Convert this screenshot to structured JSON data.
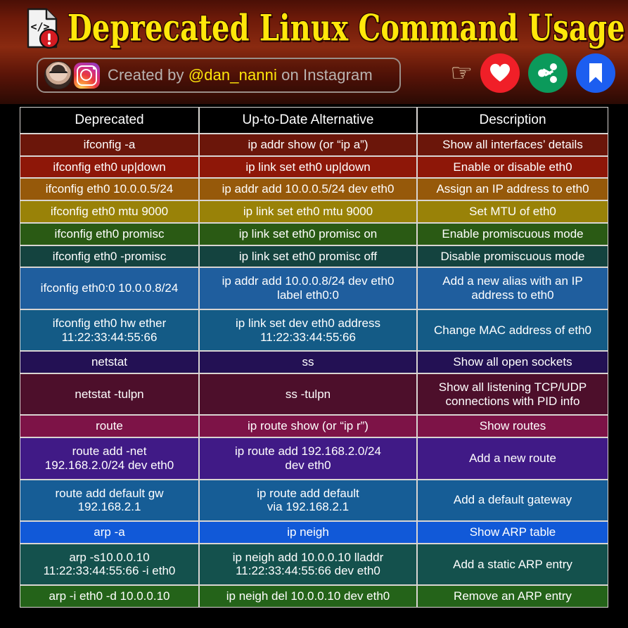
{
  "header": {
    "title": "Deprecated Linux Command Usage",
    "doc_icon": "code-document-alert-icon",
    "credit": {
      "avatar_icon": "user-avatar",
      "instagram_icon": "instagram-icon",
      "prefix": "Created by ",
      "handle": "@dan_nanni",
      "suffix": " on Instagram"
    },
    "actions": [
      {
        "name": "pointing-hand-icon",
        "glyph": "☞"
      },
      {
        "name": "heart-icon",
        "label": "Like"
      },
      {
        "name": "share-icon",
        "label": "Share"
      },
      {
        "name": "bookmark-icon",
        "label": "Save"
      }
    ],
    "colors": {
      "title_text": "#ffe70a",
      "handle_text": "#ffe70a",
      "credit_text": "#b9b3b0",
      "heart_bg": "#f01f28",
      "share_bg": "#0b9a5b",
      "save_bg": "#1c5ef0",
      "header_bg": "#6d1a09"
    }
  },
  "table": {
    "columns": [
      "Deprecated",
      "Up-to-Date Alternative",
      "Description"
    ],
    "header_bg": "#000000",
    "border_color": "#d9d5d2",
    "rows": [
      {
        "deprecated": "ifconfig -a",
        "alternative": "ip addr show (or “ip a”)",
        "description": "Show all interfaces’ details",
        "bg": "#6b160a",
        "tall": false
      },
      {
        "deprecated": "ifconfig eth0 up|down",
        "alternative": "ip link set eth0 up|down",
        "description": "Enable or disable eth0",
        "bg": "#8e1708",
        "tall": false
      },
      {
        "deprecated": "ifconfig eth0 10.0.0.5/24",
        "alternative": "ip addr add 10.0.0.5/24  dev eth0",
        "description": "Assign an IP address to eth0",
        "bg": "#96590a",
        "tall": false
      },
      {
        "deprecated": "ifconfig eth0 mtu 9000",
        "alternative": "ip link set eth0 mtu 9000",
        "description": "Set MTU of eth0",
        "bg": "#998208",
        "tall": false
      },
      {
        "deprecated": "ifconfig eth0 promisc",
        "alternative": "ip link set eth0 promisc on",
        "description": "Enable promiscuous mode",
        "bg": "#2a5a14",
        "tall": false
      },
      {
        "deprecated": "ifconfig eth0 -promisc",
        "alternative": "ip link set eth0 promisc off",
        "description": "Disable promiscuous mode",
        "bg": "#14433f",
        "tall": false
      },
      {
        "deprecated": "ifconfig eth0:0 10.0.0.8/24",
        "alternative": "ip addr add 10.0.0.8/24 dev eth0\nlabel eth0:0",
        "description": "Add a new alias with an IP\naddress to eth0",
        "bg": "#1f5e9e",
        "tall": true
      },
      {
        "deprecated": "ifconfig eth0 hw ether\n11:22:33:44:55:66",
        "alternative": "ip link set dev eth0 address\n11:22:33:44:55:66",
        "description": "Change MAC address of eth0",
        "bg": "#145b86",
        "tall": true
      },
      {
        "deprecated": "netstat",
        "alternative": "ss",
        "description": "Show all open sockets",
        "bg": "#231154",
        "tall": false
      },
      {
        "deprecated": "netstat -tulpn",
        "alternative": "ss -tulpn",
        "description": "Show all  listening TCP/UDP\nconnections with PID info",
        "bg": "#4d0f2b",
        "tall": true
      },
      {
        "deprecated": "route",
        "alternative": "ip route show (or “ip r”)",
        "description": "Show routes",
        "bg": "#7d1347",
        "tall": false
      },
      {
        "deprecated": "route add -net\n192.168.2.0/24 dev eth0",
        "alternative": "ip route add 192.168.2.0/24\ndev eth0",
        "description": "Add a new route",
        "bg": "#401a86",
        "tall": true
      },
      {
        "deprecated": "route add default gw\n192.168.2.1",
        "alternative": "ip route add default\nvia 192.168.2.1",
        "description": "Add a default gateway",
        "bg": "#165d96",
        "tall": true
      },
      {
        "deprecated": "arp -a",
        "alternative": "ip neigh",
        "description": "Show ARP table",
        "bg": "#1159d8",
        "tall": false
      },
      {
        "deprecated": "arp -s10.0.0.10\n11:22:33:44:55:66 -i eth0",
        "alternative": "ip neigh add 10.0.0.10 lladdr\n11:22:33:44:55:66 dev eth0",
        "description": "Add a static ARP entry",
        "bg": "#14514d",
        "tall": true
      },
      {
        "deprecated": "arp -i eth0 -d 10.0.0.10",
        "alternative": "ip neigh del 10.0.0.10 dev eth0",
        "description": "Remove an ARP entry",
        "bg": "#246319",
        "tall": false
      }
    ]
  }
}
